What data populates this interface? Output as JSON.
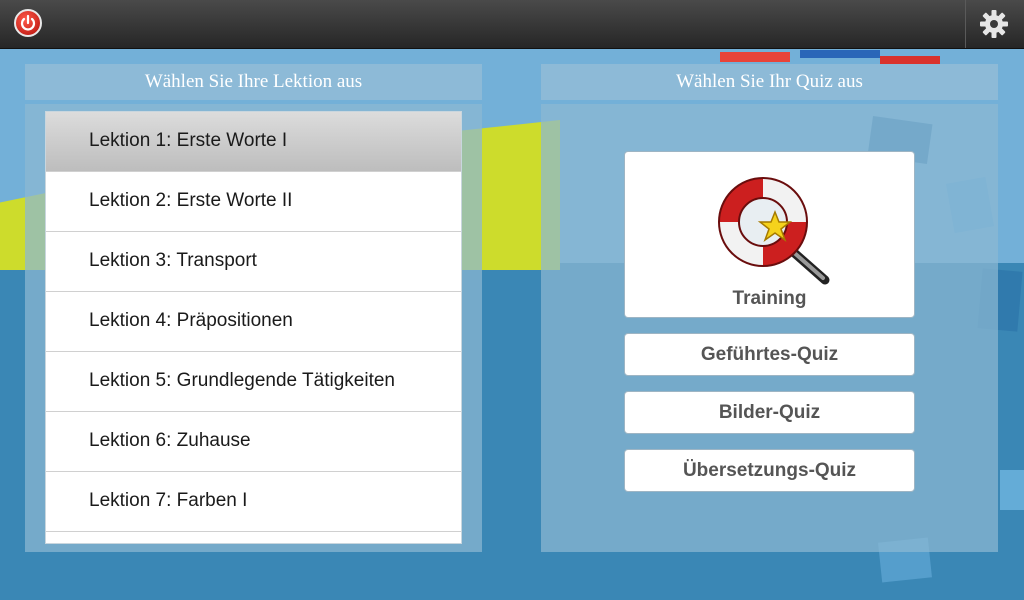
{
  "topbar": {
    "power_icon": "power-icon",
    "settings_icon": "gear-icon"
  },
  "lessons_panel": {
    "title": "Wählen Sie Ihre Lektion aus",
    "items": [
      {
        "label": "Lektion 1: Erste Worte I",
        "selected": true
      },
      {
        "label": "Lektion 2: Erste Worte II",
        "selected": false
      },
      {
        "label": "Lektion 3: Transport",
        "selected": false
      },
      {
        "label": "Lektion 4: Präpositionen",
        "selected": false
      },
      {
        "label": "Lektion 5: Grundlegende Tätigkeiten",
        "selected": false
      },
      {
        "label": "Lektion 6: Zuhause",
        "selected": false
      },
      {
        "label": "Lektion 7: Farben I",
        "selected": false
      }
    ]
  },
  "quiz_panel": {
    "title": "Wählen Sie Ihr Quiz aus",
    "training": {
      "label": "Training",
      "icon": "lifebuoy-magnifier-icon"
    },
    "buttons": [
      {
        "label": "Geführtes-Quiz"
      },
      {
        "label": "Bilder-Quiz"
      },
      {
        "label": "Übersetzungs-Quiz"
      }
    ]
  },
  "colors": {
    "topbar": "#2f2f2f",
    "sky": "#73b0d8",
    "lime": "#cddc2c",
    "water": "#3a87b5",
    "selected_row": "#c4c4c4"
  }
}
